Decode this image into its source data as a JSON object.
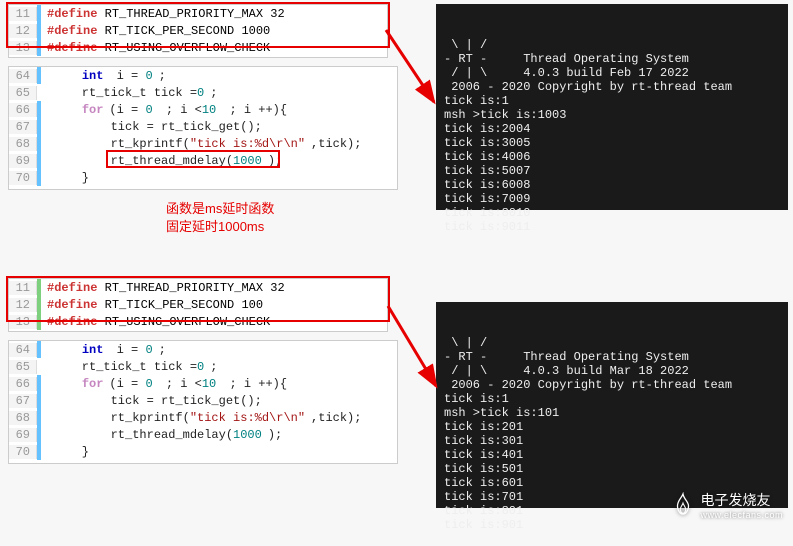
{
  "top_defines": {
    "lines": [
      {
        "n": "11",
        "mod": "blue",
        "tokens": [
          {
            "t": "#define",
            "c": "define"
          },
          {
            "t": " RT_THREAD_PRIORITY_MAX 32",
            "c": "ident"
          }
        ]
      },
      {
        "n": "12",
        "mod": "blue",
        "tokens": [
          {
            "t": "#define",
            "c": "define"
          },
          {
            "t": " RT_TICK_PER_SECOND 1000",
            "c": "ident"
          }
        ]
      },
      {
        "n": "13",
        "mod": "blue",
        "tokens": [
          {
            "t": "#define",
            "c": "define"
          },
          {
            "t": " RT_USING_OVERFLOW_CHECK",
            "c": "ident"
          }
        ]
      }
    ]
  },
  "top_code": {
    "lines": [
      {
        "n": "64",
        "mod": "blue",
        "tokens": [
          {
            "t": "    ",
            "c": "code"
          },
          {
            "t": "int",
            "c": "type"
          },
          {
            "t": " i = ",
            "c": "code"
          },
          {
            "t": "0",
            "c": "num"
          },
          {
            "t": ";",
            "c": "code"
          }
        ]
      },
      {
        "n": "65",
        "mod": "",
        "tokens": [
          {
            "t": "    rt_tick_t tick =",
            "c": "code"
          },
          {
            "t": "0",
            "c": "num"
          },
          {
            "t": ";",
            "c": "code"
          }
        ]
      },
      {
        "n": "66",
        "mod": "blue",
        "tokens": [
          {
            "t": "    ",
            "c": "code"
          },
          {
            "t": "for",
            "c": "kw"
          },
          {
            "t": "(i = ",
            "c": "code"
          },
          {
            "t": "0",
            "c": "num"
          },
          {
            "t": " ; i <",
            "c": "code"
          },
          {
            "t": "10",
            "c": "num"
          },
          {
            "t": " ; i ++){",
            "c": "code"
          }
        ]
      },
      {
        "n": "67",
        "mod": "blue",
        "tokens": [
          {
            "t": "        tick = rt_tick_get();",
            "c": "code"
          }
        ]
      },
      {
        "n": "68",
        "mod": "blue",
        "tokens": [
          {
            "t": "        rt_kprintf(",
            "c": "code"
          },
          {
            "t": "\"tick is:%d\\r\\n\"",
            "c": "str"
          },
          {
            "t": ",tick);",
            "c": "code"
          }
        ]
      },
      {
        "n": "69",
        "mod": "blue",
        "tokens": [
          {
            "t": "        rt_thread_mdelay(",
            "c": "code"
          },
          {
            "t": "1000",
            "c": "num"
          },
          {
            "t": ");",
            "c": "code"
          }
        ]
      },
      {
        "n": "70",
        "mod": "blue",
        "tokens": [
          {
            "t": "    }",
            "c": "code"
          }
        ]
      }
    ]
  },
  "bottom_defines": {
    "lines": [
      {
        "n": "11",
        "mod": "green",
        "tokens": [
          {
            "t": "#define",
            "c": "define"
          },
          {
            "t": " RT_THREAD_PRIORITY_MAX 32",
            "c": "ident"
          }
        ]
      },
      {
        "n": "12",
        "mod": "green",
        "tokens": [
          {
            "t": "#define",
            "c": "define"
          },
          {
            "t": " RT_TICK_PER_SECOND 100",
            "c": "ident"
          }
        ]
      },
      {
        "n": "13",
        "mod": "green",
        "tokens": [
          {
            "t": "#define",
            "c": "define"
          },
          {
            "t": " RT_USING_OVERFLOW_CHECK",
            "c": "ident"
          }
        ]
      }
    ]
  },
  "bottom_code": {
    "lines": [
      {
        "n": "64",
        "mod": "blue",
        "tokens": [
          {
            "t": "    ",
            "c": "code"
          },
          {
            "t": "int",
            "c": "type"
          },
          {
            "t": " i = ",
            "c": "code"
          },
          {
            "t": "0",
            "c": "num"
          },
          {
            "t": ";",
            "c": "code"
          }
        ]
      },
      {
        "n": "65",
        "mod": "",
        "tokens": [
          {
            "t": "    rt_tick_t tick =",
            "c": "code"
          },
          {
            "t": "0",
            "c": "num"
          },
          {
            "t": ";",
            "c": "code"
          }
        ]
      },
      {
        "n": "66",
        "mod": "blue",
        "tokens": [
          {
            "t": "    ",
            "c": "code"
          },
          {
            "t": "for",
            "c": "kw"
          },
          {
            "t": "(i = ",
            "c": "code"
          },
          {
            "t": "0",
            "c": "num"
          },
          {
            "t": " ; i <",
            "c": "code"
          },
          {
            "t": "10",
            "c": "num"
          },
          {
            "t": " ; i ++){",
            "c": "code"
          }
        ]
      },
      {
        "n": "67",
        "mod": "blue",
        "tokens": [
          {
            "t": "        tick = rt_tick_get();",
            "c": "code"
          }
        ]
      },
      {
        "n": "68",
        "mod": "blue",
        "tokens": [
          {
            "t": "        rt_kprintf(",
            "c": "code"
          },
          {
            "t": "\"tick is:%d\\r\\n\"",
            "c": "str"
          },
          {
            "t": ",tick);",
            "c": "code"
          }
        ]
      },
      {
        "n": "69",
        "mod": "blue",
        "tokens": [
          {
            "t": "        rt_thread_mdelay(",
            "c": "code"
          },
          {
            "t": "1000",
            "c": "num"
          },
          {
            "t": ");",
            "c": "code"
          }
        ]
      },
      {
        "n": "70",
        "mod": "blue",
        "tokens": [
          {
            "t": "    }",
            "c": "code"
          }
        ]
      }
    ]
  },
  "term_top": [
    " \\ | /",
    "- RT -     Thread Operating System",
    " / | \\     4.0.3 build Feb 17 2022",
    " 2006 - 2020 Copyright by rt-thread team",
    "tick is:1",
    "msh >tick is:1003",
    "tick is:2004",
    "tick is:3005",
    "tick is:4006",
    "tick is:5007",
    "tick is:6008",
    "tick is:7009",
    "tick is:8010",
    "tick is:9011"
  ],
  "term_bottom": [
    " \\ | /",
    "- RT -     Thread Operating System",
    " / | \\     4.0.3 build Mar 18 2022",
    " 2006 - 2020 Copyright by rt-thread team",
    "tick is:1",
    "msh >tick is:101",
    "tick is:201",
    "tick is:301",
    "tick is:401",
    "tick is:501",
    "tick is:601",
    "tick is:701",
    "tick is:801",
    "tick is:901"
  ],
  "annotation": {
    "line1": "函数是ms延时函数",
    "line2": "固定延时1000ms"
  },
  "watermark": {
    "title": "电子发烧友",
    "url": "www.elecfans.com"
  }
}
